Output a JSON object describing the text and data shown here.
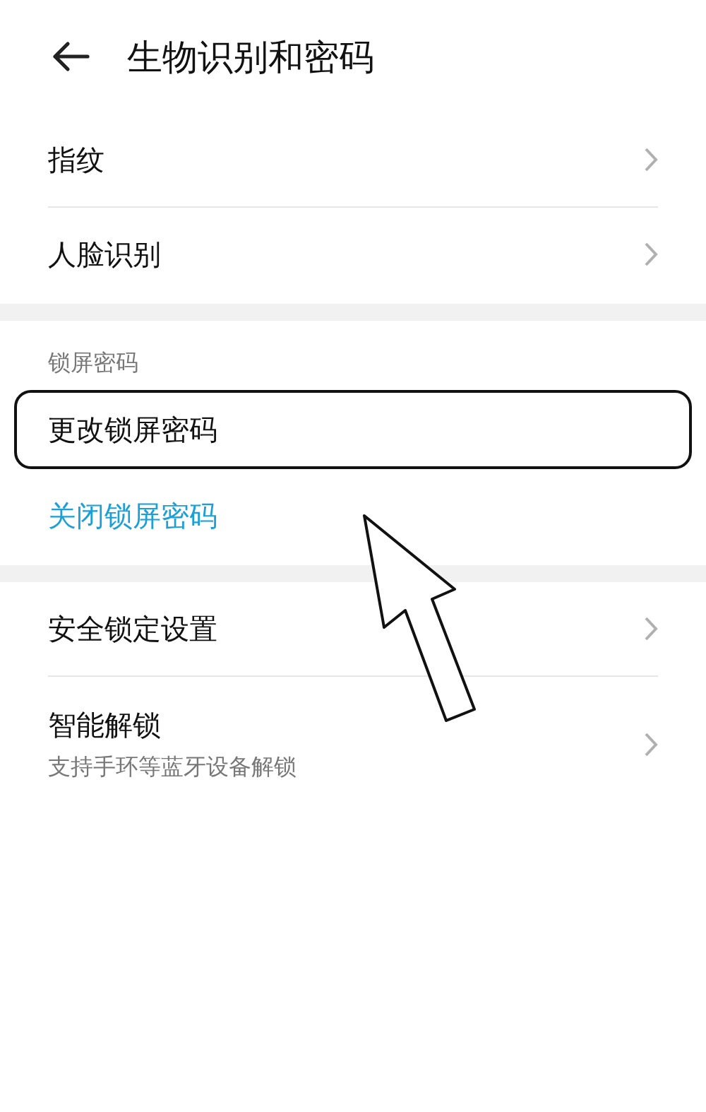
{
  "header": {
    "title": "生物识别和密码"
  },
  "sections": [
    {
      "items": [
        {
          "kind": "nav",
          "label": "指纹"
        },
        {
          "kind": "nav",
          "label": "人脸识别"
        }
      ]
    },
    {
      "header": "锁屏密码",
      "items": [
        {
          "kind": "plain",
          "label": "更改锁屏密码",
          "highlighted": true
        },
        {
          "kind": "action",
          "label": "关闭锁屏密码"
        }
      ]
    },
    {
      "items": [
        {
          "kind": "nav",
          "label": "安全锁定设置"
        },
        {
          "kind": "nav",
          "label": "智能解锁",
          "subtitle": "支持手环等蓝牙设备解锁"
        }
      ]
    }
  ]
}
